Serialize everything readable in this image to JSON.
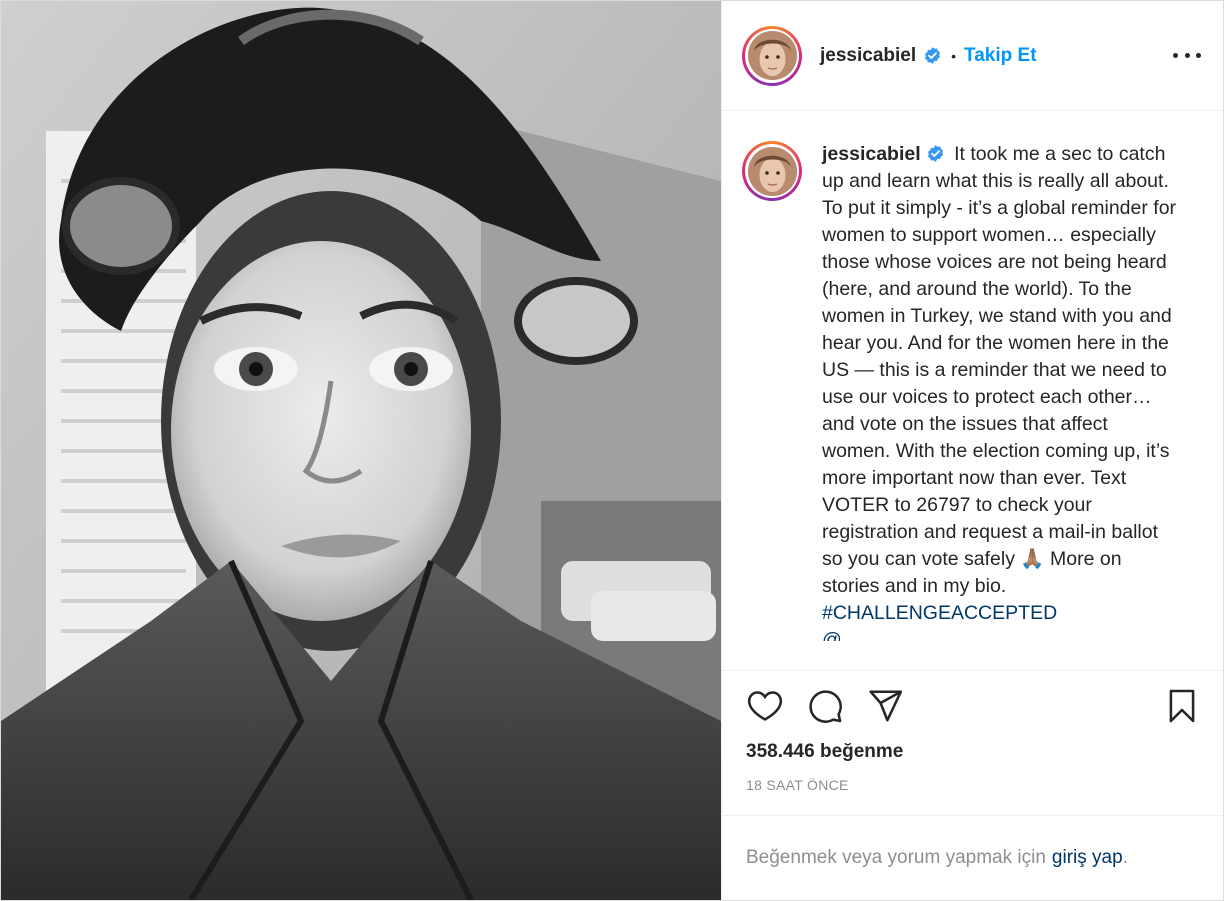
{
  "post": {
    "author": {
      "username": "jessicabiel",
      "verified": true,
      "follow_label": "Takip Et",
      "separator": "•"
    },
    "caption": {
      "username": "jessicabiel",
      "text": "It took me a sec to catch up and learn what this is really all about. To put it simply - it’s a global reminder for women to support women… especially those whose voices are not being heard (here, and around the world). To the women in Turkey, we stand with you and hear you. And for the women here in the US — this is a reminder that we need to use our voices to protect each other… and vote on the issues that affect women. With the election coming up, it’s more important now than ever. Text VOTER to 26797 to check your registration and request a mail-in ballot so you can vote safely 🙏🏽 More on stories and in my bio.",
      "hashtag": "#CHALLENGEACCEPTED",
      "mention_partial": "@..."
    },
    "likes": "358.446 beğenme",
    "time_ago": "18 SAAT ÖNCE",
    "login_prompt": "Beğenmek veya yorum yapmak için",
    "login_link": "giriş yap",
    "login_suffix": "."
  },
  "icons": {
    "like": "heart-icon",
    "comment": "comment-icon",
    "share": "share-icon",
    "save": "bookmark-icon",
    "more": "more-options-icon",
    "verified": "verified-badge-icon"
  },
  "colors": {
    "link_blue": "#0095f6",
    "hashtag": "#00376b",
    "muted": "#8e8e8e",
    "verified": "#3897f0"
  }
}
